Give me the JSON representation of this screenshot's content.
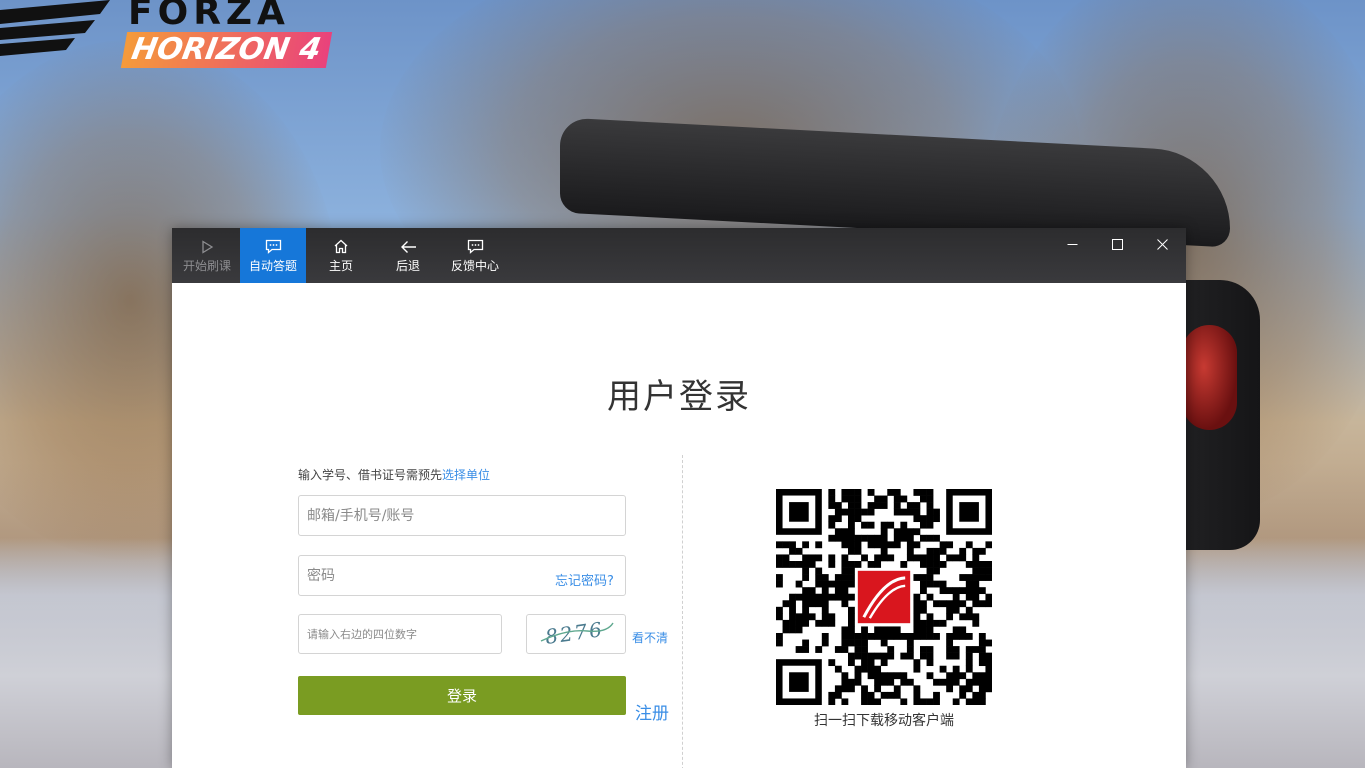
{
  "desktop": {
    "logo": {
      "line1": "FORZA",
      "line2": "HORIZON 4"
    }
  },
  "toolbar": {
    "items": [
      {
        "label": "开始刷课",
        "icon": "play-icon",
        "state": "disabled"
      },
      {
        "label": "自动答题",
        "icon": "chat-icon",
        "state": "active"
      },
      {
        "label": "主页",
        "icon": "home-icon",
        "state": "normal"
      },
      {
        "label": "后退",
        "icon": "back-arrow-icon",
        "state": "normal"
      },
      {
        "label": "反馈中心",
        "icon": "feedback-icon",
        "state": "normal"
      }
    ],
    "window_controls": [
      "minimize-icon",
      "maximize-icon",
      "close-icon"
    ],
    "active_color": "#1677d9"
  },
  "login": {
    "title": "用户登录",
    "hint_text": "输入学号、借书证号需预先",
    "hint_link": "选择单位",
    "account_placeholder": "邮箱/手机号/账号",
    "password_placeholder": "密码",
    "forgot_password": "忘记密码?",
    "captcha_placeholder": "请输入右边的四位数字",
    "captcha_value": "8276",
    "captcha_refresh": "看不清",
    "login_button": "登录",
    "register": "注册",
    "button_color": "#7a9c22",
    "link_color": "#3a8ee6"
  },
  "qr": {
    "caption": "扫一扫下载移动客户端",
    "center_logo_color": "#d9161e"
  }
}
